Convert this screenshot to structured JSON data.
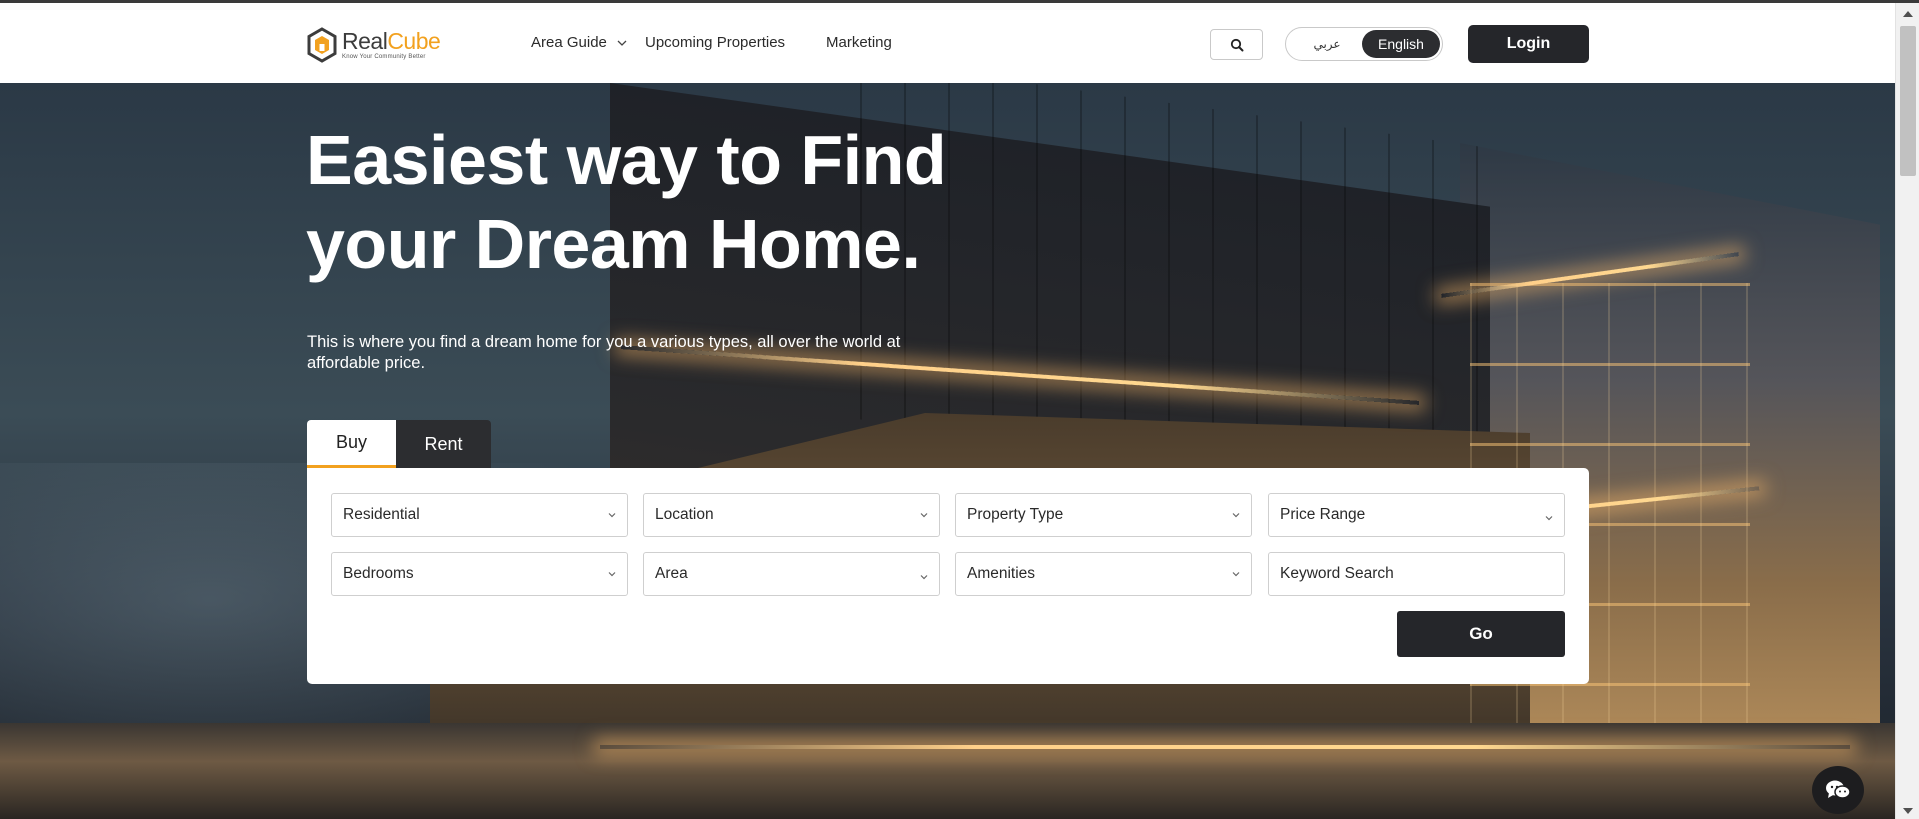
{
  "brand": {
    "name_part1": "Real",
    "name_part2": "Cube",
    "tagline": "Know Your Community Better",
    "accent_color": "#f2a11f",
    "dark_color": "#25262a"
  },
  "nav": {
    "area_guide": "Area Guide",
    "upcoming": "Upcoming Properties",
    "marketing": "Marketing",
    "search_icon": "search-icon"
  },
  "lang": {
    "arabic": "عربي",
    "english": "English",
    "selected": "English"
  },
  "login": "Login",
  "hero": {
    "headline_line1": "Easiest way to Find",
    "headline_line2": "your Dream Home.",
    "subtext": "This is where you find a dream home for you a various types, all over the world at affordable price."
  },
  "search": {
    "tabs": [
      "Buy",
      "Rent"
    ],
    "active_tab": "Buy",
    "category": "Residential",
    "location": "Location",
    "property_type": "Property Type",
    "price_range": "Price Range",
    "bedrooms": "Bedrooms",
    "area": "Area",
    "amenities": "Amenities",
    "keyword_placeholder": "Keyword Search",
    "go": "Go"
  },
  "chat": {
    "icon": "chat-bubbles-icon"
  }
}
